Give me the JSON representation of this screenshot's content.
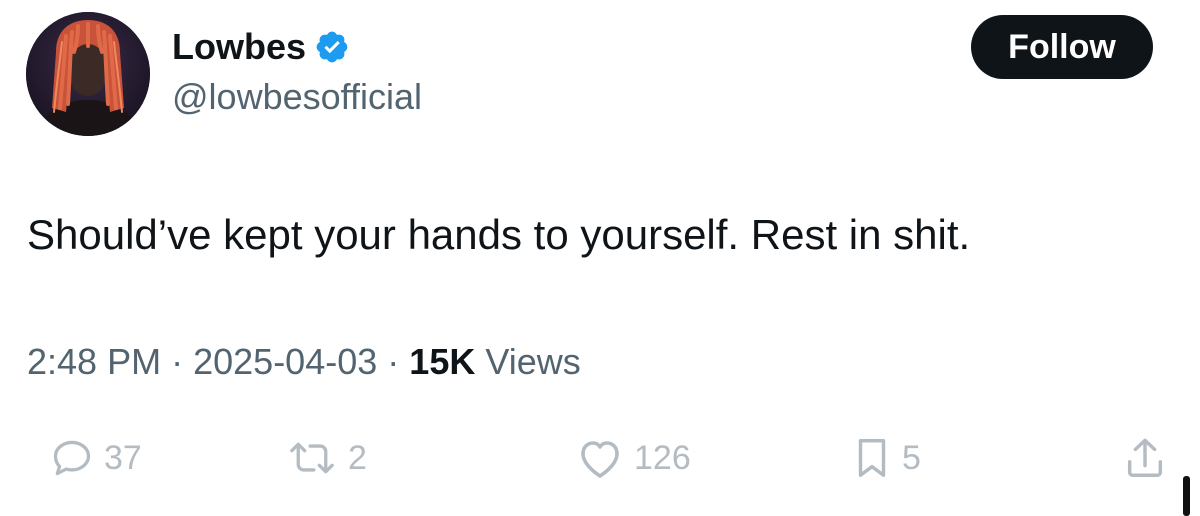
{
  "author": {
    "display_name": "Lowbes",
    "handle": "@lowbesofficial",
    "verified_icon": "verified-badge-icon",
    "avatar_icon": "profile-photo"
  },
  "follow_button": {
    "label": "Follow"
  },
  "tweet": {
    "text": "Should’ve kept your hands to yourself. Rest in shit.",
    "time": "2:48 PM",
    "separator": "·",
    "date": "2025-04-03",
    "views_count": "15K",
    "views_label": "Views"
  },
  "actions": {
    "replies": {
      "icon": "reply-icon",
      "count": "37"
    },
    "reposts": {
      "icon": "repost-icon",
      "count": "2"
    },
    "likes": {
      "icon": "like-icon",
      "count": "126"
    },
    "bookmarks": {
      "icon": "bookmark-icon",
      "count": "5"
    },
    "share": {
      "icon": "share-icon"
    }
  },
  "colors": {
    "text": "#0f1419",
    "secondary": "#536471",
    "action_muted": "#b4bcc3",
    "verified": "#1d9bf0",
    "button_bg": "#0f1419"
  }
}
